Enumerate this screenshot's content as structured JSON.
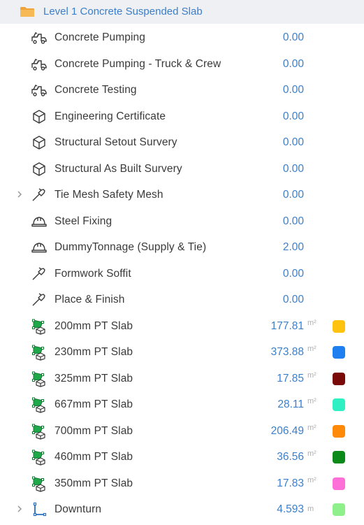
{
  "header": {
    "title": "Level 1 Concrete Suspended Slab",
    "icon": "folder-icon"
  },
  "rows": [
    {
      "label": "Concrete Pumping",
      "value": "0.00",
      "unit": "",
      "icon": "truck-icon",
      "expandable": false,
      "color": null
    },
    {
      "label": "Concrete Pumping - Truck & Crew",
      "value": "0.00",
      "unit": "",
      "icon": "truck-icon",
      "expandable": false,
      "color": null
    },
    {
      "label": "Concrete Testing",
      "value": "0.00",
      "unit": "",
      "icon": "truck-icon",
      "expandable": false,
      "color": null
    },
    {
      "label": "Engineering Certificate",
      "value": "0.00",
      "unit": "",
      "icon": "box-icon",
      "expandable": false,
      "color": null
    },
    {
      "label": "Structural Setout Survery",
      "value": "0.00",
      "unit": "",
      "icon": "box-icon",
      "expandable": false,
      "color": null
    },
    {
      "label": "Structural As Built Survery",
      "value": "0.00",
      "unit": "",
      "icon": "box-icon",
      "expandable": false,
      "color": null
    },
    {
      "label": "Tie Mesh Safety Mesh",
      "value": "0.00",
      "unit": "",
      "icon": "hammer-icon",
      "expandable": true,
      "color": null
    },
    {
      "label": "Steel Fixing",
      "value": "0.00",
      "unit": "",
      "icon": "hardhat-icon",
      "expandable": false,
      "color": null
    },
    {
      "label": "DummyTonnage (Supply & Tie)",
      "value": "2.00",
      "unit": "",
      "icon": "hardhat-icon",
      "expandable": false,
      "color": null
    },
    {
      "label": "Formwork Soffit",
      "value": "0.00",
      "unit": "",
      "icon": "hammer-icon",
      "expandable": false,
      "color": null
    },
    {
      "label": "Place & Finish",
      "value": "0.00",
      "unit": "",
      "icon": "hammer-icon",
      "expandable": false,
      "color": null
    },
    {
      "label": "200mm PT Slab",
      "value": "177.81",
      "unit": "m²",
      "icon": "area-takeoff-icon",
      "expandable": false,
      "color": "#ffc20e"
    },
    {
      "label": "230mm PT Slab",
      "value": "373.88",
      "unit": "m²",
      "icon": "area-takeoff-icon",
      "expandable": false,
      "color": "#1e7ff0"
    },
    {
      "label": "325mm PT Slab",
      "value": "17.85",
      "unit": "m²",
      "icon": "area-takeoff-icon",
      "expandable": false,
      "color": "#7a0a0a"
    },
    {
      "label": "667mm PT Slab",
      "value": "28.11",
      "unit": "m²",
      "icon": "area-takeoff-icon",
      "expandable": false,
      "color": "#2ef0c2"
    },
    {
      "label": "700mm PT Slab",
      "value": "206.49",
      "unit": "m²",
      "icon": "area-takeoff-icon",
      "expandable": false,
      "color": "#ff8a0a"
    },
    {
      "label": "460mm PT Slab",
      "value": "36.56",
      "unit": "m²",
      "icon": "area-takeoff-icon",
      "expandable": false,
      "color": "#0b8a1a"
    },
    {
      "label": "350mm PT Slab",
      "value": "17.83",
      "unit": "m²",
      "icon": "area-takeoff-icon",
      "expandable": false,
      "color": "#ff6fd8"
    },
    {
      "label": "Downturn",
      "value": "4.593",
      "unit": "m",
      "icon": "linear-takeoff-icon",
      "expandable": true,
      "color": "#8ef08a"
    }
  ]
}
